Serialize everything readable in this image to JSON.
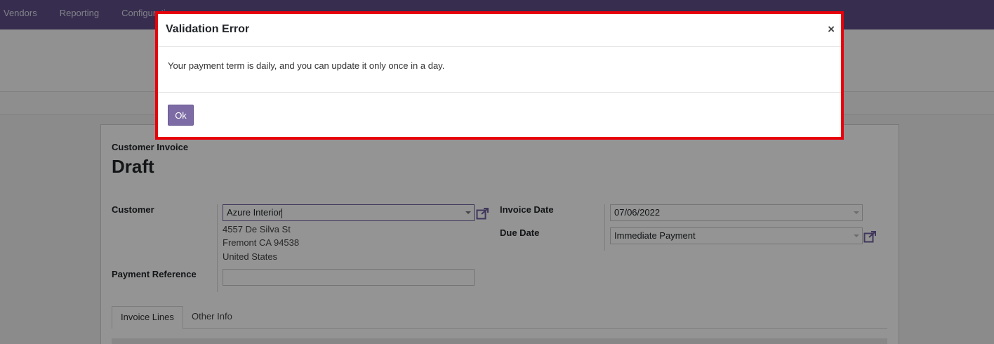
{
  "nav": {
    "items": [
      {
        "label": "Vendors"
      },
      {
        "label": "Reporting"
      },
      {
        "label": "Configuration"
      }
    ]
  },
  "form": {
    "document_type": "Customer Invoice",
    "state": "Draft",
    "customer_label": "Customer",
    "customer_value": "Azure Interior",
    "address_lines": [
      "4557 De Silva St",
      "Fremont CA 94538",
      "United States"
    ],
    "payment_reference_label": "Payment Reference",
    "payment_reference_value": "",
    "invoice_date_label": "Invoice Date",
    "invoice_date_value": "07/06/2022",
    "due_date_label": "Due Date",
    "due_date_value": "Immediate Payment"
  },
  "tabs": [
    {
      "label": "Invoice Lines",
      "active": true
    },
    {
      "label": "Other Info",
      "active": false
    }
  ],
  "dialog": {
    "title": "Validation Error",
    "close_glyph": "×",
    "message": "Your payment term is daily, and you can update it only once in a day.",
    "ok_label": "Ok",
    "highlight_color": "#e8000b",
    "button_color": "#7c6ba4"
  },
  "colors": {
    "navbar": "#5e4f89",
    "accent": "#6f5f9e"
  },
  "icons": {
    "external_link": "external-link-icon",
    "dropdown": "chevron-down-icon",
    "close": "close-icon"
  }
}
